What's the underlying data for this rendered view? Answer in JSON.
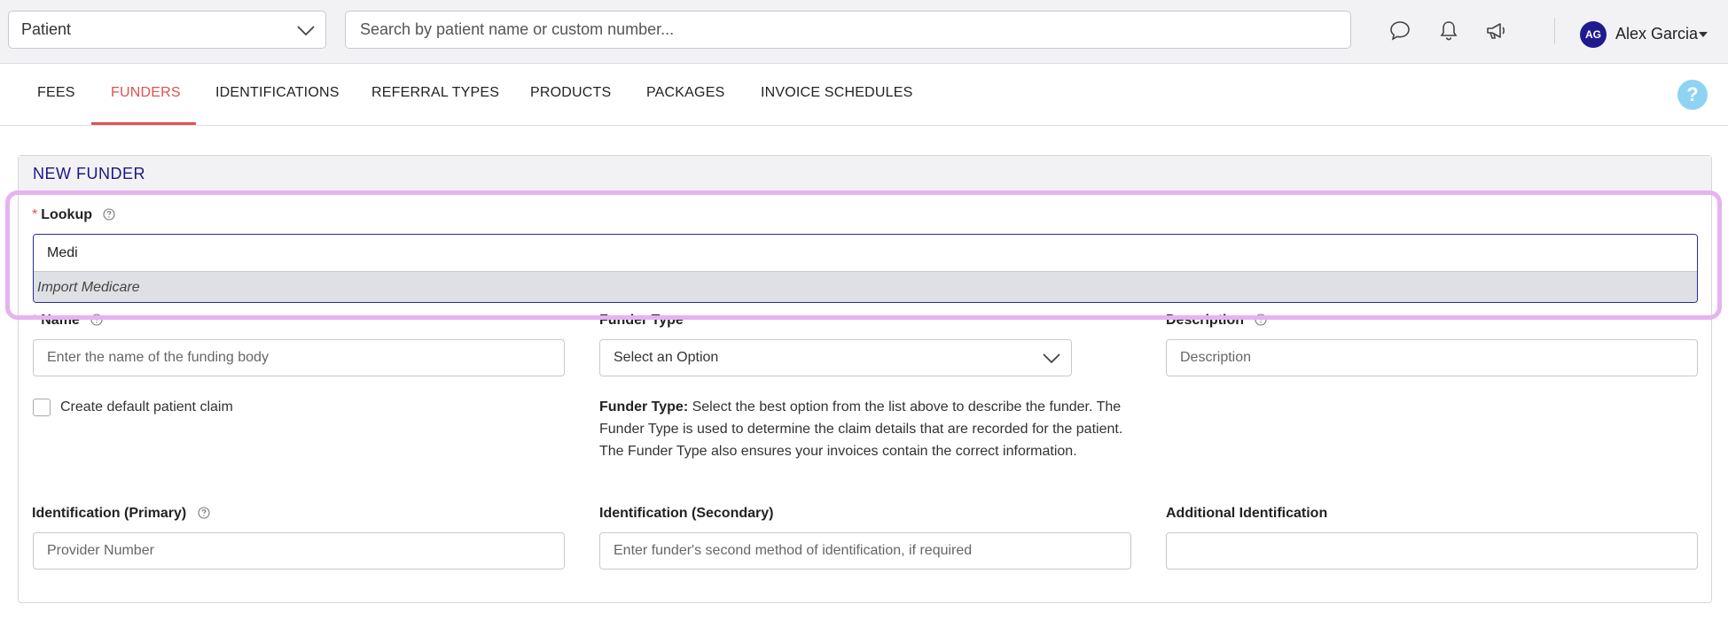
{
  "header": {
    "context_select": "Patient",
    "search_placeholder": "Search by patient name or custom number...",
    "user": {
      "initials": "AG",
      "name": "Alex Garcia"
    },
    "icons": [
      "chat-icon",
      "bell-icon",
      "megaphone-icon"
    ]
  },
  "tabs": [
    {
      "label": "FEES",
      "active": false
    },
    {
      "label": "FUNDERS",
      "active": true
    },
    {
      "label": "IDENTIFICATIONS",
      "active": false
    },
    {
      "label": "REFERRAL TYPES",
      "active": false
    },
    {
      "label": "PRODUCTS",
      "active": false
    },
    {
      "label": "PACKAGES",
      "active": false
    },
    {
      "label": "INVOICE SCHEDULES",
      "active": false
    }
  ],
  "help_label": "?",
  "panel": {
    "title": "NEW FUNDER",
    "lookup": {
      "required_mark": "*",
      "label": "Lookup",
      "value": "Medi",
      "option": "Import Medicare"
    },
    "name": {
      "label": "Name",
      "placeholder": "Enter the name of the funding body"
    },
    "funder_type": {
      "label": "Funder Type",
      "value": "Select an Option"
    },
    "description": {
      "label": "Description",
      "placeholder": "Description"
    },
    "default_claim": {
      "label": "Create default patient claim",
      "checked": false
    },
    "funder_type_help": {
      "bold": "Funder Type:",
      "text": " Select the best option from the list above to describe the funder. The Funder Type is used to determine the claim details that are recorded for the patient. The Funder Type also ensures your invoices contain the correct information."
    },
    "id_primary": {
      "label": "Identification (Primary)",
      "placeholder": "Provider Number"
    },
    "id_secondary": {
      "label": "Identification (Secondary)",
      "placeholder": "Enter funder's second method of identification, if required"
    },
    "id_additional": {
      "label": "Additional Identification",
      "value": ""
    }
  },
  "colors": {
    "accent": "#e05252",
    "title": "#1a1787",
    "avatar": "#1f1b8f",
    "help": "#8fd3f4",
    "highlight": "#e6b2f2"
  }
}
